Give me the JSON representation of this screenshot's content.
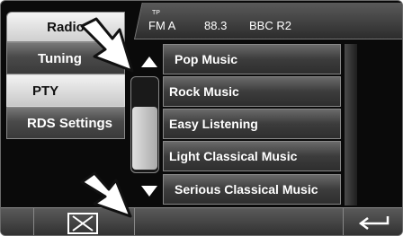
{
  "tabs": {
    "radio": "Radio"
  },
  "menu": {
    "tuning": "Tuning",
    "pty": "PTY",
    "rds": "RDS Settings"
  },
  "status": {
    "tp": "TP",
    "band": "FM A",
    "frequency": "88.3",
    "station": "BBC R2"
  },
  "pty_list": [
    "Pop Music",
    "Rock Music",
    "Easy Listening",
    "Light Classical Music",
    "Serious Classical Music"
  ],
  "icons": {
    "scroll_up": "triangle-up-icon",
    "scroll_down": "triangle-down-icon",
    "close": "close-icon",
    "back": "return-arrow-icon",
    "pointer": "pointer-arrow-icon"
  },
  "colors": {
    "screen_bg": "#0a0a0a",
    "active_bg": "#e0e0e0",
    "text": "#ffffff"
  }
}
